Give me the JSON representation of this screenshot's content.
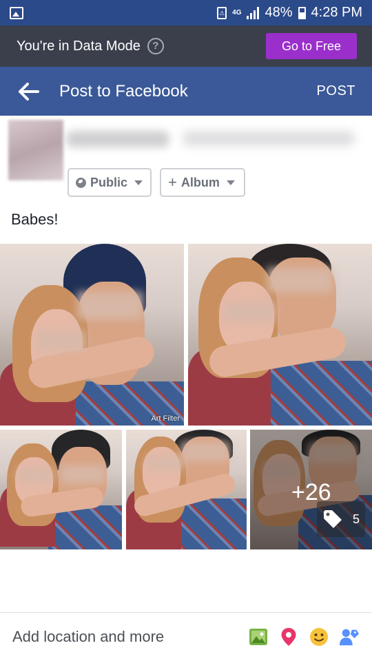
{
  "status_bar": {
    "network": "4G",
    "battery": "48%",
    "time": "4:28 PM"
  },
  "data_banner": {
    "message": "You're in Data Mode",
    "help_symbol": "?",
    "button_label": "Go to Free",
    "button_color": "#9b2fcb"
  },
  "header": {
    "title": "Post to Facebook",
    "post_label": "POST",
    "color": "#3b5998"
  },
  "audience": {
    "privacy_label": "Public",
    "album_label": "Album"
  },
  "post": {
    "text": "Babes!"
  },
  "photos": {
    "filter_label": "Art Filter",
    "more_count": "+26",
    "tag_count": "5"
  },
  "bottom_bar": {
    "label": "Add location and more",
    "icons": [
      "photo-icon",
      "location-pin-icon",
      "emoji-icon",
      "tag-people-icon"
    ]
  }
}
